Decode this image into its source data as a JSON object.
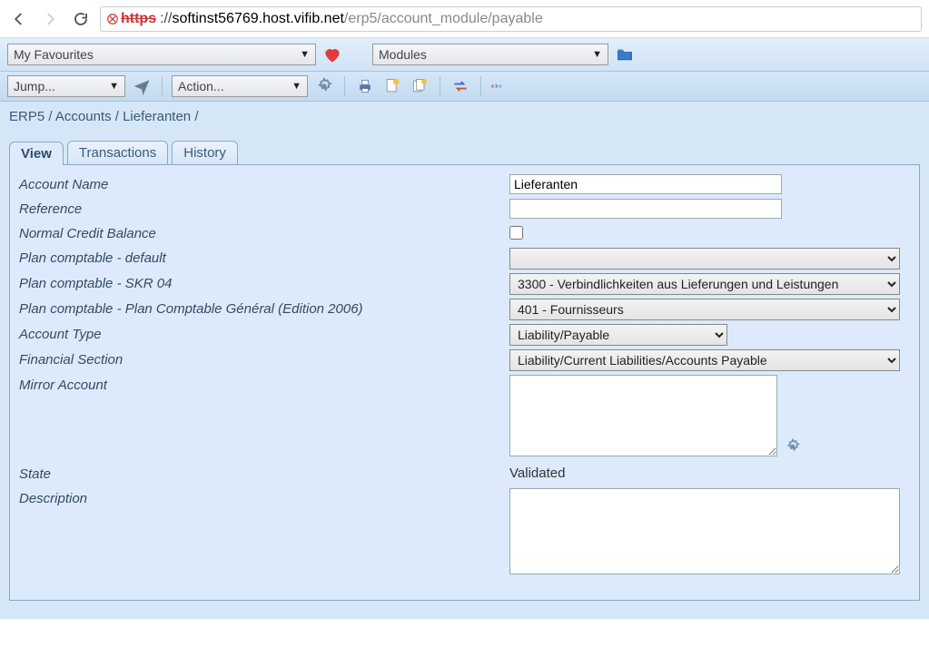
{
  "browser": {
    "url_scheme_strike": "https",
    "url_sep": "://",
    "url_host": "softinst56769.host.vifib.net",
    "url_path": "/erp5/account_module/payable"
  },
  "top": {
    "fav_label": "My Favourites",
    "modules_label": "Modules",
    "jump_label": "Jump...",
    "action_label": "Action..."
  },
  "breadcrumb": {
    "p1": "ERP5",
    "p2": "Accounts",
    "p3": "Lieferanten",
    "sep": " / "
  },
  "tabs": {
    "view": "View",
    "transactions": "Transactions",
    "history": "History"
  },
  "fields": {
    "account_name_label": "Account Name",
    "account_name_value": "Lieferanten",
    "reference_label": "Reference",
    "reference_value": "",
    "normal_credit_label": "Normal Credit Balance",
    "plan_default_label": "Plan comptable - default",
    "plan_default_value": "",
    "plan_skr04_label": "Plan comptable - SKR 04",
    "plan_skr04_value": "3300 - Verbindlichkeiten aus Lieferungen und Leistungen",
    "plan_pcg_label": "Plan comptable - Plan Comptable Général (Edition 2006)",
    "plan_pcg_value": "401 - Fournisseurs",
    "account_type_label": "Account Type",
    "account_type_value": "Liability/Payable",
    "financial_section_label": "Financial Section",
    "financial_section_value": "Liability/Current Liabilities/Accounts Payable",
    "mirror_label": "Mirror Account",
    "mirror_value": "",
    "state_label": "State",
    "state_value": "Validated",
    "description_label": "Description",
    "description_value": ""
  }
}
